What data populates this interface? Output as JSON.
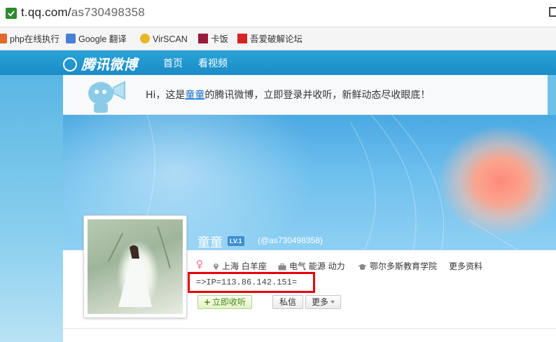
{
  "browser": {
    "url_host": "t.qq.com/",
    "url_path": "as730498358",
    "bookmarks": [
      {
        "label": "php在线执行",
        "icon": "php-icon"
      },
      {
        "label": "Google 翻译",
        "icon": "translate-icon"
      },
      {
        "label": "VirSCAN",
        "icon": "virscan-icon"
      },
      {
        "label": "卡饭",
        "icon": "kafan-icon"
      },
      {
        "label": "吾爱破解论坛",
        "icon": "52pojie-icon"
      }
    ]
  },
  "site": {
    "logo": "腾讯微博",
    "nav": [
      "首页",
      "看视频"
    ],
    "accent_color": "#1a8cc6"
  },
  "welcome": {
    "prefix": "Hi，这是",
    "user_link": "童童",
    "suffix": "的腾讯微博，立即登录并收听，新鲜动态尽收眼底！"
  },
  "profile": {
    "name": "童童",
    "level": "LV.1",
    "handle": "(@as730498358)",
    "gender_icon": "female-icon",
    "location": "上海 白羊座",
    "job": "电气 能源 动力",
    "school": "鄂尔多斯教育学院",
    "more_info": "更多资料",
    "ip_text": "=>IP=113.86.142.151=",
    "highlight_color": "#e8000b"
  },
  "actions": {
    "follow": "立即收听",
    "message": "私信",
    "more": "更多"
  }
}
